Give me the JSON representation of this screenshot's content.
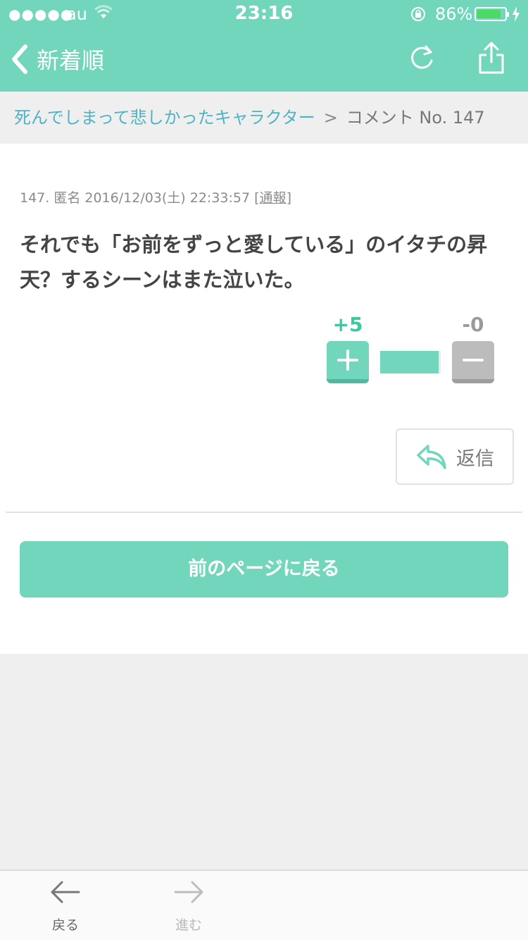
{
  "status_bar": {
    "signal": "●●●●●",
    "carrier": "au",
    "time": "23:16",
    "battery_percent": "86%",
    "battery_level": 0.86
  },
  "nav": {
    "back_label": "新着順",
    "reload_icon": "reload-icon",
    "share_icon": "share-icon"
  },
  "breadcrumb": {
    "topic": "死んでしまって悲しかったキャラクター",
    "separator": ">",
    "current": "コメント No. 147"
  },
  "comment": {
    "meta": "147. 匿名 2016/12/03(土) 22:33:57 [",
    "report": "通報",
    "meta_end": "]",
    "body": "それでも「お前をずっと愛している」のイタチの昇天？するシーンはまた泣いた。"
  },
  "votes": {
    "plus_count": "+5",
    "minus_count": "-0",
    "plus_share": 0.97
  },
  "actions": {
    "reply_label": "返信",
    "back_page_label": "前のページに戻る"
  },
  "toolbar": {
    "back_label": "戻る",
    "forward_label": "進む"
  },
  "colors": {
    "accent": "#72d6bd",
    "link": "#4fb3c6",
    "plus_text": "#3cc9a2",
    "minus_button": "#bcbcbc"
  }
}
